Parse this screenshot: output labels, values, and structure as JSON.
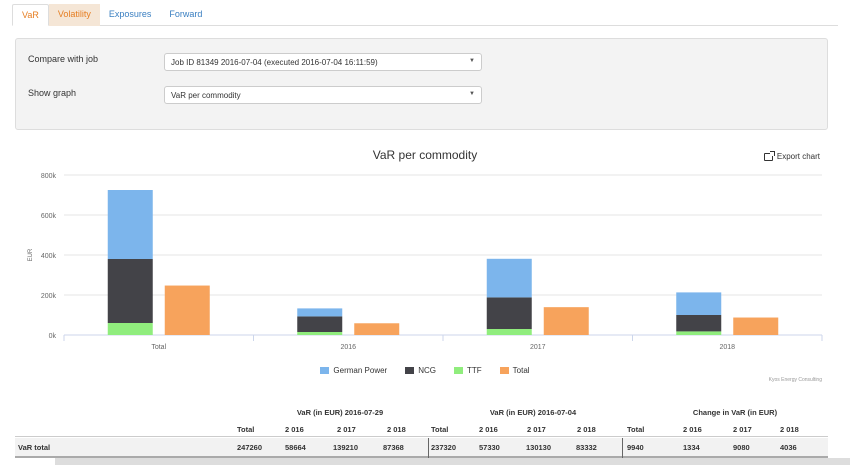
{
  "tabs": [
    {
      "label": "VaR",
      "active": true
    },
    {
      "label": "Volatility",
      "active": false
    },
    {
      "label": "Exposures",
      "active": false
    },
    {
      "label": "Forward",
      "active": false
    }
  ],
  "form": {
    "compare_label": "Compare with job",
    "compare_value": "Job ID 81349 2016-07-04 (executed 2016-07-04 16:11:59)",
    "graph_label": "Show graph",
    "graph_value": "VaR per commodity"
  },
  "chart_data": {
    "type": "bar",
    "title": "VaR per commodity",
    "ylabel": "EUR",
    "xlabel": "",
    "ylim": [
      0,
      800000
    ],
    "yticks": [
      0,
      200000,
      400000,
      600000,
      800000
    ],
    "ytick_labels": [
      "0k",
      "200k",
      "400k",
      "600k",
      "800k"
    ],
    "categories": [
      "Total",
      "2016",
      "2017",
      "2018"
    ],
    "stacked_series": [
      {
        "name": "German Power",
        "color": "#7cb5ec",
        "values": [
          345000,
          40000,
          193000,
          113000
        ]
      },
      {
        "name": "NCG",
        "color": "#434348",
        "values": [
          320000,
          78000,
          158000,
          82000
        ]
      },
      {
        "name": "TTF",
        "color": "#90ed7d",
        "values": [
          60000,
          15000,
          30000,
          18000
        ]
      }
    ],
    "total_series": {
      "name": "Total",
      "color": "#f7a35c",
      "values": [
        247260,
        58664,
        139210,
        87368
      ]
    },
    "legend_position": "bottom-center",
    "credit": "Kyos Energy Consulting"
  },
  "chart_ui": {
    "export_label": "Export chart"
  },
  "table": {
    "groups": [
      "VaR (in EUR) 2016-07-29",
      "VaR (in EUR) 2016-07-04",
      "Change in VaR (in EUR)"
    ],
    "columns": [
      "Total",
      "2 016",
      "2 017",
      "2 018"
    ],
    "row_label": "VaR total",
    "values": [
      [
        "247260",
        "58664",
        "139210",
        "87368"
      ],
      [
        "237320",
        "57330",
        "130130",
        "83332"
      ],
      [
        "9940",
        "1334",
        "9080",
        "4036"
      ]
    ]
  }
}
